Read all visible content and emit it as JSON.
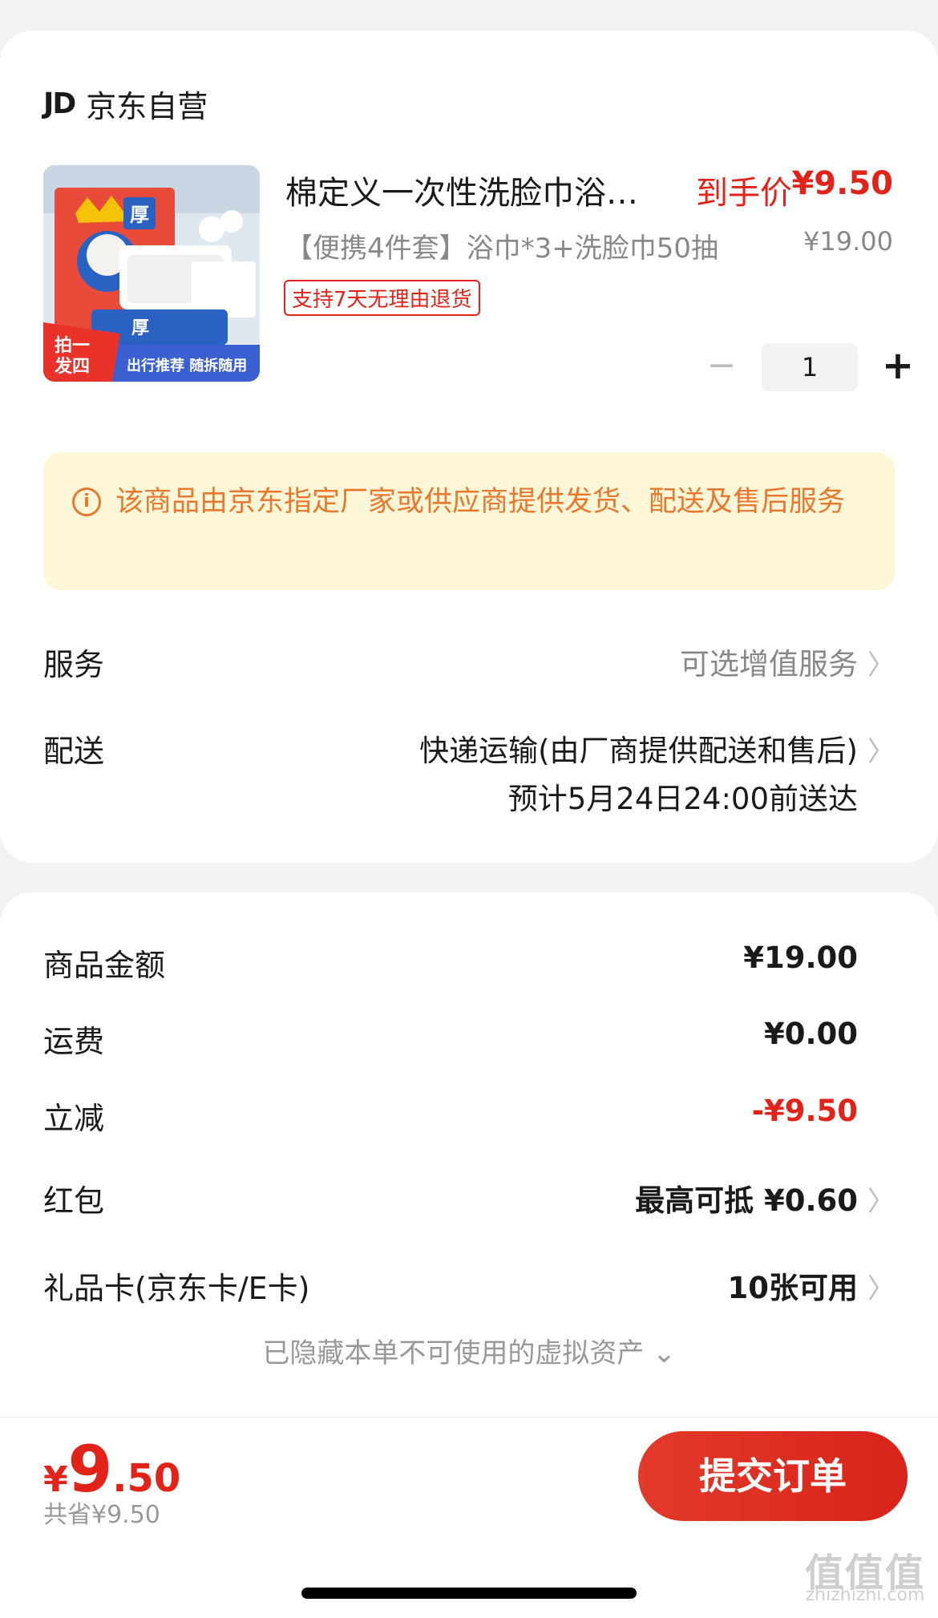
{
  "shop": {
    "logo": "JD",
    "name": "京东自营"
  },
  "product": {
    "title": "棉定义一次性洗脸巾浴…",
    "price_label": "到手价",
    "price": "¥9.50",
    "spec": "【便携4件套】浴巾*3+洗脸巾50抽",
    "original_price": "¥19.00",
    "tag": "支持7天无理由退货",
    "quantity": "1",
    "image_text": {
      "thick": "厚",
      "promo": "拍一发四",
      "bottom": "出行推荐 随拆随用"
    }
  },
  "notice": {
    "icon": "i",
    "text": "该商品由京东指定厂家或供应商提供发货、配送及售后服务"
  },
  "service": {
    "label": "服务",
    "value": "可选增值服务"
  },
  "delivery": {
    "label": "配送",
    "method": "快递运输(由厂商提供配送和售后)",
    "eta": "预计5月24日24:00前送达"
  },
  "summary": {
    "goods": {
      "label": "商品金额",
      "value": "¥19.00"
    },
    "shipping": {
      "label": "运费",
      "value": "¥0.00"
    },
    "discount": {
      "label": "立减",
      "value": "-¥9.50"
    },
    "red_packet": {
      "label": "红包",
      "value": "最高可抵 ¥0.60"
    },
    "gift_card": {
      "label": "礼品卡(京东卡/E卡)",
      "value": "10张可用"
    },
    "hidden_assets": "已隐藏本单不可使用的虚拟资产 ⌄"
  },
  "bottom": {
    "currency": "¥",
    "total_int": "9",
    "total_dec": ".50",
    "saved": "共省¥9.50",
    "submit": "提交订单"
  },
  "watermark": {
    "big": "值值值",
    "small": "zhizhizhi.com"
  },
  "colors": {
    "accent": "#e2231a",
    "notice_text": "#e8782e",
    "notice_bg": "#fdf7d8"
  }
}
